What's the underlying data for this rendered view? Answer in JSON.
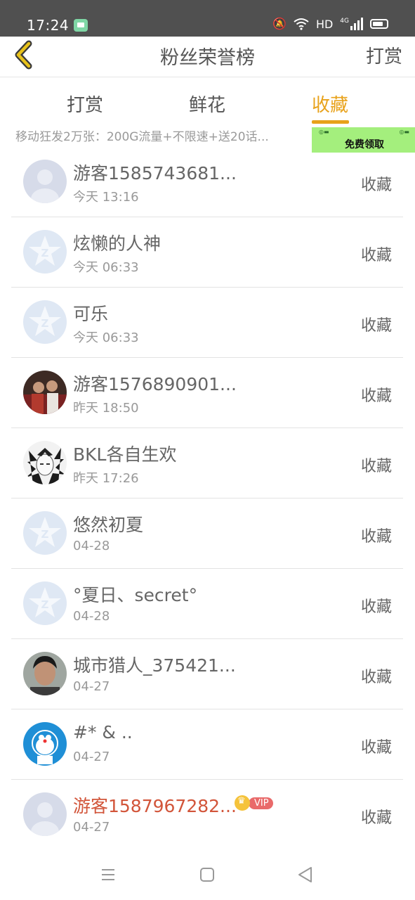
{
  "status_bar": {
    "time": "17:24",
    "network": "HD",
    "signal": "4G"
  },
  "header": {
    "back_icon": "chevron-left-icon",
    "title": "粉丝荣誉榜",
    "reward_link": "打赏"
  },
  "tabs": [
    {
      "label": "打赏",
      "active": false
    },
    {
      "label": "鲜花",
      "active": false
    },
    {
      "label": "收藏",
      "active": true
    }
  ],
  "ad": {
    "text": "移动狂发2万张：200G流量+不限速+送20话...",
    "banner_button": "免费领取"
  },
  "colors": {
    "accent": "#e8a21b",
    "vip_name": "#d2553a",
    "ad_green": "#a4ef7d"
  },
  "list": [
    {
      "name": "游客1585743681...",
      "time": "今天 13:16",
      "action": "收藏",
      "avatar": "default-avatar"
    },
    {
      "name": "炫懒的人神",
      "time": "今天 06:33",
      "action": "收藏",
      "avatar": "qq-star-avatar"
    },
    {
      "name": "可乐",
      "time": "今天 06:33",
      "action": "收藏",
      "avatar": "qq-star-avatar"
    },
    {
      "name": "游客1576890901...",
      "time": "昨天 18:50",
      "action": "收藏",
      "avatar": "photo-avatar"
    },
    {
      "name": "BKL各自生欢",
      "time": "昨天 17:26",
      "action": "收藏",
      "avatar": "anime-avatar"
    },
    {
      "name": "悠然初夏",
      "time": "04-28",
      "action": "收藏",
      "avatar": "qq-star-avatar"
    },
    {
      "name": "°夏日、secret°",
      "time": "04-28",
      "action": "收藏",
      "avatar": "qq-star-avatar"
    },
    {
      "name": "城市猎人_375421...",
      "time": "04-27",
      "action": "收藏",
      "avatar": "photo-avatar"
    },
    {
      "name": "#* & ..",
      "time": "04-27",
      "action": "收藏",
      "avatar": "doraemon-avatar"
    },
    {
      "name": "游客1587967282...",
      "time": "04-27",
      "action": "收藏",
      "avatar": "default-avatar",
      "vip": "VIP"
    }
  ]
}
